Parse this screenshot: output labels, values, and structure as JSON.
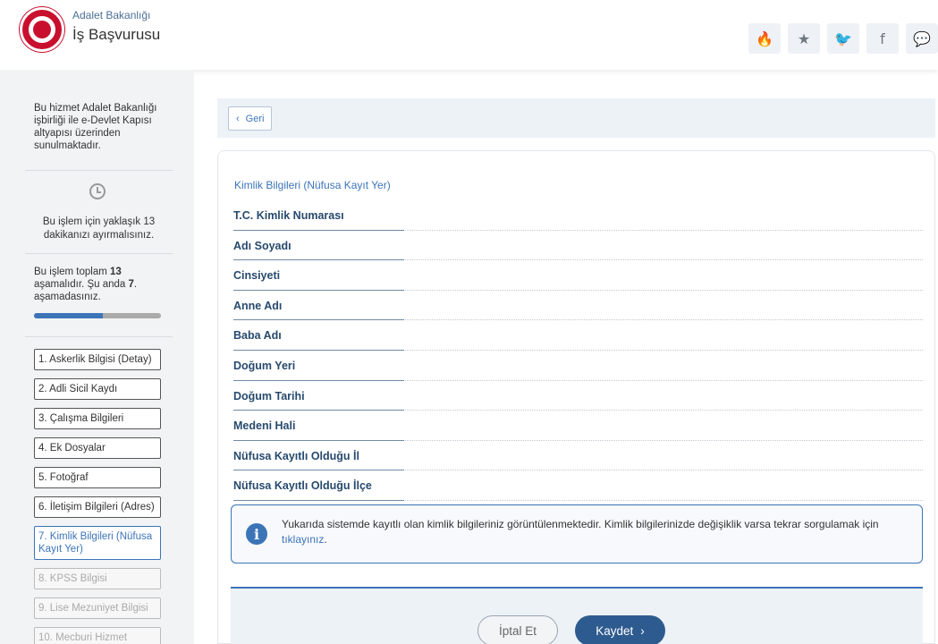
{
  "header": {
    "org_name": "Adalet Bakanlığı",
    "service_name": "İş Başvurusu",
    "icons": [
      {
        "name": "fire-icon",
        "glyph": "🔥"
      },
      {
        "name": "star-icon",
        "glyph": "★"
      },
      {
        "name": "twitter-icon",
        "glyph": "🐦"
      },
      {
        "name": "facebook-icon",
        "glyph": "f"
      },
      {
        "name": "chat-icon",
        "glyph": "💬"
      }
    ]
  },
  "sidebar": {
    "intro": "Bu hizmet Adalet Bakanlığı işbirliği ile e-Devlet Kapısı altyapısı üzerinden sunulmaktadır.",
    "time_text": "Bu işlem için yaklaşık 13 dakikanızı ayırmalısınız.",
    "steps_info_prefix": "Bu işlem toplam ",
    "steps_total": "13",
    "steps_info_mid": " aşamalıdır. Şu anda ",
    "steps_current": "7",
    "steps_info_suffix": ". aşamadasınız.",
    "progress_fraction": 0.54,
    "steps": [
      {
        "label": "1. Askerlik Bilgisi (Detay)",
        "state": "done"
      },
      {
        "label": "2. Adli Sicil Kaydı",
        "state": "done"
      },
      {
        "label": "3. Çalışma Bilgileri",
        "state": "done"
      },
      {
        "label": "4. Ek Dosyalar",
        "state": "done"
      },
      {
        "label": "5. Fotoğraf",
        "state": "done"
      },
      {
        "label": "6. İletişim Bilgileri (Adres)",
        "state": "done"
      },
      {
        "label": "7. Kimlik Bilgileri (Nüfusa Kayıt Yer)",
        "state": "active"
      },
      {
        "label": "8. KPSS Bilgisi",
        "state": "disabled"
      },
      {
        "label": "9. Lise Mezuniyet Bilgisi",
        "state": "disabled"
      },
      {
        "label": "10. Mecburi Hizmet",
        "state": "disabled"
      }
    ]
  },
  "main": {
    "back_label": "Geri",
    "section_title": "Kimlik Bilgileri (Nüfusa Kayıt Yer)",
    "fields": [
      {
        "label": "T.C. Kimlik Numarası",
        "value": ""
      },
      {
        "label": "Adı Soyadı",
        "value": ""
      },
      {
        "label": "Cinsiyeti",
        "value": ""
      },
      {
        "label": "Anne Adı",
        "value": ""
      },
      {
        "label": "Baba Adı",
        "value": ""
      },
      {
        "label": "Doğum Yeri",
        "value": ""
      },
      {
        "label": "Doğum Tarihi",
        "value": ""
      },
      {
        "label": "Medeni Hali",
        "value": ""
      },
      {
        "label": "Nüfusa Kayıtlı Olduğu İl",
        "value": ""
      },
      {
        "label": "Nüfusa Kayıtlı Olduğu İlçe",
        "value": ""
      }
    ],
    "info_text": "Yukarıda sistemde kayıtlı olan kimlik bilgileriniz görüntülenmektedir. Kimlik bilgilerinizde değişiklik varsa tekrar sorgulamak için ",
    "info_link": "tıklayınız",
    "info_suffix": ".",
    "cancel_label": "İptal Et",
    "save_label": "Kaydet"
  }
}
